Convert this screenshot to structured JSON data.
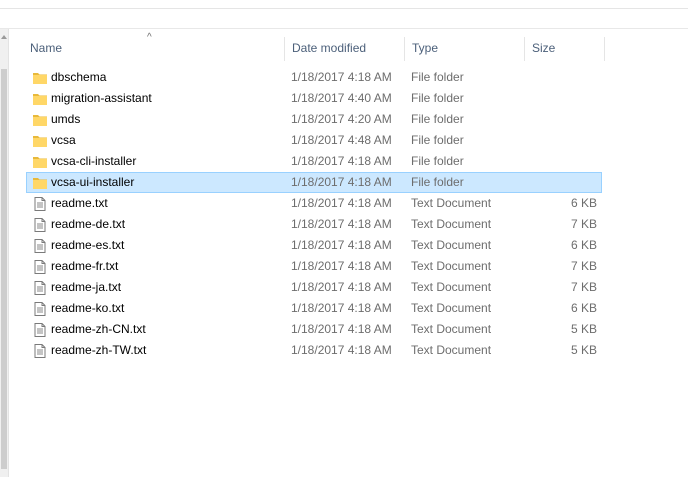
{
  "header": {
    "name": "Name",
    "date_modified": "Date modified",
    "type": "Type",
    "size": "Size",
    "sort_indicator": "^"
  },
  "colors": {
    "folder": "#ffd767",
    "folder_dark": "#e8b93b",
    "selection_bg": "#cce8ff",
    "selection_border": "#99d1ff",
    "header_text": "#4c607a",
    "secondary_text": "#6d6d6d"
  },
  "files": [
    {
      "name": "dbschema",
      "date": "1/18/2017 4:18 AM",
      "type": "File folder",
      "size": "",
      "icon": "folder-icon",
      "selected": false
    },
    {
      "name": "migration-assistant",
      "date": "1/18/2017 4:40 AM",
      "type": "File folder",
      "size": "",
      "icon": "folder-icon",
      "selected": false
    },
    {
      "name": "umds",
      "date": "1/18/2017 4:20 AM",
      "type": "File folder",
      "size": "",
      "icon": "folder-icon",
      "selected": false
    },
    {
      "name": "vcsa",
      "date": "1/18/2017 4:48 AM",
      "type": "File folder",
      "size": "",
      "icon": "folder-icon",
      "selected": false
    },
    {
      "name": "vcsa-cli-installer",
      "date": "1/18/2017 4:18 AM",
      "type": "File folder",
      "size": "",
      "icon": "folder-icon",
      "selected": false
    },
    {
      "name": "vcsa-ui-installer",
      "date": "1/18/2017 4:18 AM",
      "type": "File folder",
      "size": "",
      "icon": "folder-icon",
      "selected": true
    },
    {
      "name": "readme.txt",
      "date": "1/18/2017 4:18 AM",
      "type": "Text Document",
      "size": "6 KB",
      "icon": "text-document-icon",
      "selected": false
    },
    {
      "name": "readme-de.txt",
      "date": "1/18/2017 4:18 AM",
      "type": "Text Document",
      "size": "7 KB",
      "icon": "text-document-icon",
      "selected": false
    },
    {
      "name": "readme-es.txt",
      "date": "1/18/2017 4:18 AM",
      "type": "Text Document",
      "size": "6 KB",
      "icon": "text-document-icon",
      "selected": false
    },
    {
      "name": "readme-fr.txt",
      "date": "1/18/2017 4:18 AM",
      "type": "Text Document",
      "size": "7 KB",
      "icon": "text-document-icon",
      "selected": false
    },
    {
      "name": "readme-ja.txt",
      "date": "1/18/2017 4:18 AM",
      "type": "Text Document",
      "size": "7 KB",
      "icon": "text-document-icon",
      "selected": false
    },
    {
      "name": "readme-ko.txt",
      "date": "1/18/2017 4:18 AM",
      "type": "Text Document",
      "size": "6 KB",
      "icon": "text-document-icon",
      "selected": false
    },
    {
      "name": "readme-zh-CN.txt",
      "date": "1/18/2017 4:18 AM",
      "type": "Text Document",
      "size": "5 KB",
      "icon": "text-document-icon",
      "selected": false
    },
    {
      "name": "readme-zh-TW.txt",
      "date": "1/18/2017 4:18 AM",
      "type": "Text Document",
      "size": "5 KB",
      "icon": "text-document-icon",
      "selected": false
    }
  ]
}
